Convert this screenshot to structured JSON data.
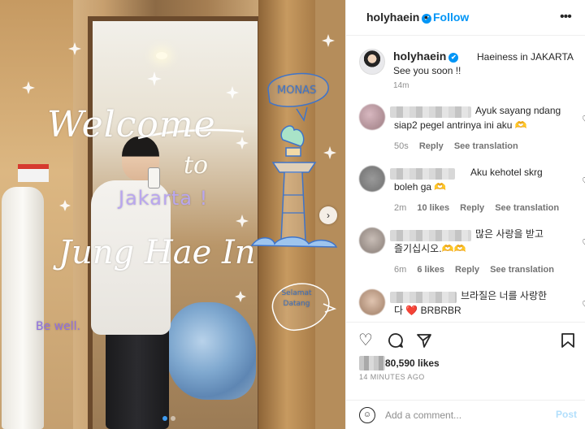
{
  "post": {
    "image": {
      "handwriting": {
        "welcome": "Welcome",
        "to": "to",
        "city": "Jakarta !",
        "name": "Jung Hae In",
        "signoff": "Be well.",
        "landmark": "MONAS",
        "greeting": "Selamat Datang"
      },
      "next_arrow": "›",
      "carousel_index": 1,
      "carousel_total": 2
    },
    "header": {
      "username": "holyhaein",
      "separator": "•",
      "follow_label": "Follow",
      "more_icon": "•••"
    },
    "caption": {
      "username": "holyhaein",
      "text_line1": "Haeiness in JAKARTA",
      "text_line2": "See you soon !!",
      "time": "14m"
    },
    "comments": [
      {
        "text_line1": "Ayuk sayang ndang",
        "text_line2": "siap2 pegel antrinya ini aku 🫶",
        "time": "50s",
        "likes": "",
        "reply": "Reply",
        "translate": "See translation",
        "avatar_color": "#b79898"
      },
      {
        "text_line1": "Aku kehotel skrg",
        "text_line2": "boleh ga 🫶",
        "time": "2m",
        "likes": "10 likes",
        "reply": "Reply",
        "translate": "See translation",
        "avatar_color": "#8f8f8f"
      },
      {
        "text_line1": "많은 사랑을 받고",
        "text_line2": "즐기십시오.🫶🫶",
        "time": "6m",
        "likes": "6 likes",
        "reply": "Reply",
        "translate": "See translation",
        "avatar_color": "#a49a94"
      },
      {
        "text_line1": "브라질은 너를 사랑한",
        "text_line2": "다 ❤️ BRBRBR",
        "time": "",
        "likes": "",
        "reply": "",
        "translate": "",
        "avatar_color": "#c3a590"
      }
    ],
    "likes_count_text": "80,590 likes",
    "time_ago": "14 MINUTES AGO",
    "add_comment": {
      "placeholder": "Add a comment...",
      "post_label": "Post"
    },
    "colors": {
      "accent": "#0095f6",
      "post_disabled": "#b2dffc",
      "heart_red": "#ed2e3f"
    },
    "icons": {
      "like": "heart-icon",
      "comment": "comment-icon",
      "share": "share-icon",
      "save": "bookmark-icon",
      "emoji": "smile-icon"
    }
  }
}
